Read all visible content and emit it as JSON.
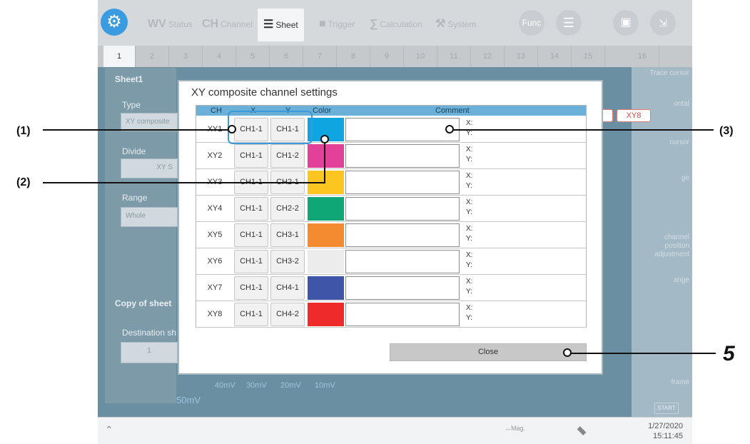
{
  "topbar": {
    "tabs": [
      {
        "icon": "WV",
        "label": "Status"
      },
      {
        "icon": "CH",
        "label": "Channel"
      },
      {
        "icon": "☰",
        "label": "Sheet"
      },
      {
        "icon": "■",
        "label": "Trigger"
      },
      {
        "icon": "∑",
        "label": "Calculation"
      },
      {
        "icon": "⚒",
        "label": "System"
      }
    ],
    "func_label": "Func"
  },
  "sheet_numbers": [
    "1",
    "2",
    "3",
    "4",
    "5",
    "6",
    "7",
    "8",
    "9",
    "10",
    "11",
    "12",
    "13",
    "14",
    "15",
    "16"
  ],
  "left_panel": {
    "sheet_title": "Sheet1",
    "type_label": "Type",
    "type_value": "XY composite",
    "divide_label": "Divide",
    "divide_value": "XY S",
    "range_label": "Range",
    "range_value": "Whole",
    "copy_label": "Copy of sheet",
    "dest_label": "Destination sh",
    "dest_value": "1"
  },
  "right_panel": {
    "items": [
      "Trace cursor",
      "ontal",
      "cursor",
      "ge",
      "channel position adjustment",
      "ange",
      "frame"
    ],
    "xy8_badge": "XY8",
    "start_label": "START"
  },
  "waveform_labels": [
    "50mV",
    "40mV",
    "30mV",
    "20mV",
    "10mV"
  ],
  "dialog": {
    "title": "XY composite channel settings",
    "headers": {
      "ch": "CH",
      "x": "X",
      "y": "Y",
      "color": "Color",
      "comment": "Comment"
    },
    "rows": [
      {
        "ch": "XY1",
        "x": "CH1-1",
        "y": "CH1-1",
        "color": "#0ea5e0"
      },
      {
        "ch": "XY2",
        "x": "CH1-1",
        "y": "CH1-2",
        "color": "#e3409a"
      },
      {
        "ch": "XY3",
        "x": "CH1-1",
        "y": "CH2-1",
        "color": "#fdc520"
      },
      {
        "ch": "XY4",
        "x": "CH1-1",
        "y": "CH2-2",
        "color": "#0ea775"
      },
      {
        "ch": "XY5",
        "x": "CH1-1",
        "y": "CH3-1",
        "color": "#f48b30"
      },
      {
        "ch": "XY6",
        "x": "CH1-1",
        "y": "CH3-2",
        "color": "#ececec"
      },
      {
        "ch": "XY7",
        "x": "CH1-1",
        "y": "CH4-1",
        "color": "#3f55a8"
      },
      {
        "ch": "XY8",
        "x": "CH1-1",
        "y": "CH4-2",
        "color": "#ee2a2a"
      }
    ],
    "x_label": "X:",
    "y_label": "Y:",
    "close_label": "Close"
  },
  "statusbar": {
    "mag_label": "Mag.",
    "date": "1/27/2020",
    "time": "15:11:45"
  },
  "callouts": {
    "c1": "(1)",
    "c2": "(2)",
    "c3": "(3)",
    "c5": "5"
  }
}
